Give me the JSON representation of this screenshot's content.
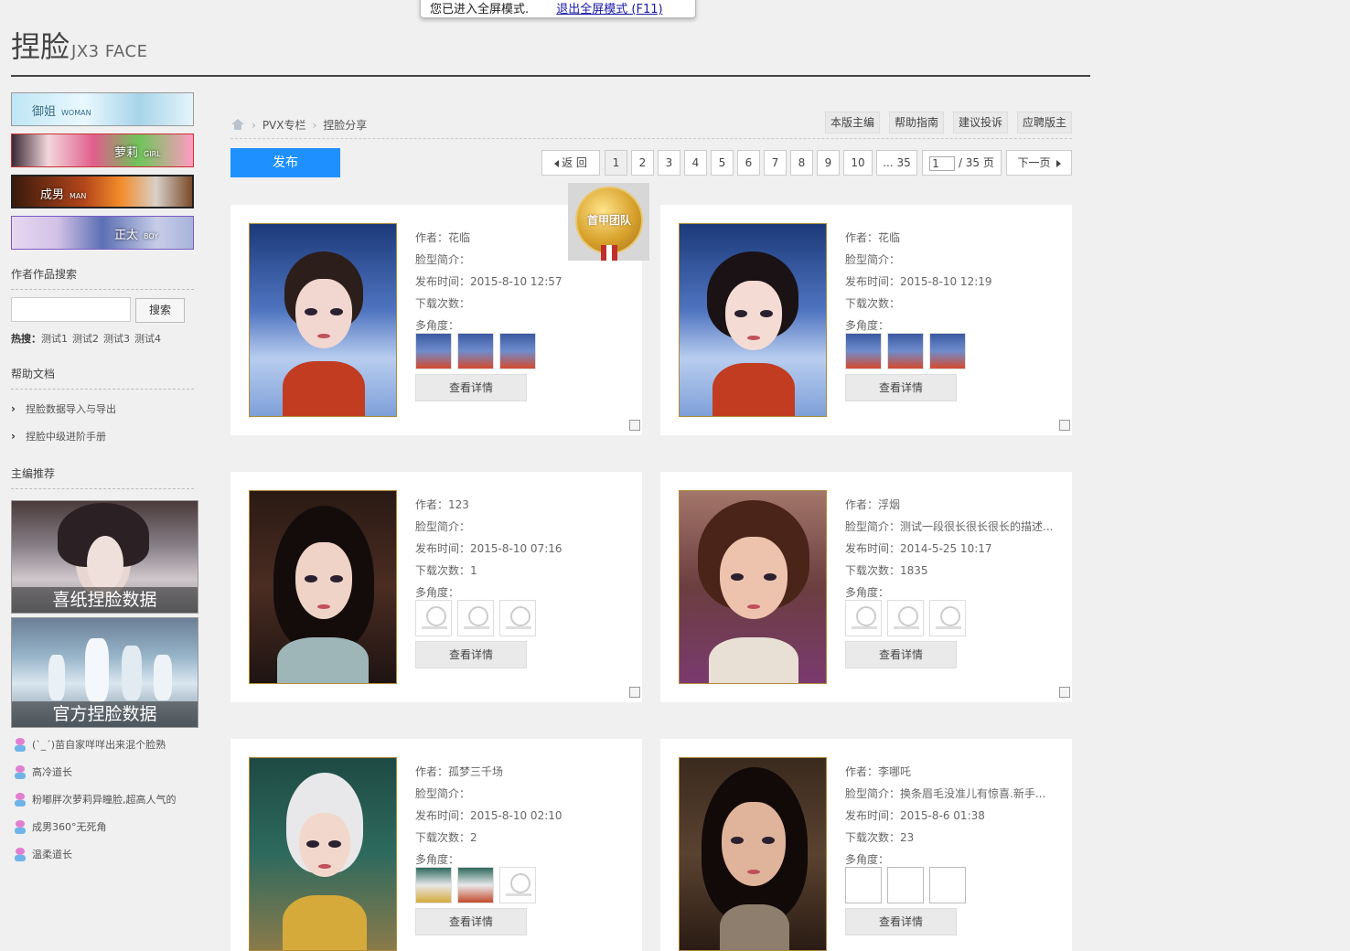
{
  "toast": {
    "message": "您已进入全屏模式.",
    "exit_link": "退出全屏模式 (F11)"
  },
  "header": {
    "title": "捏脸",
    "subtitle": "JX3 FACE"
  },
  "sidebar": {
    "banners": [
      {
        "label": "御姐",
        "en": "WOMAN"
      },
      {
        "label": "萝莉",
        "en": "GIRL"
      },
      {
        "label": "成男",
        "en": "MAN"
      },
      {
        "label": "正太",
        "en": "BOY"
      }
    ],
    "search": {
      "heading": "作者作品搜索",
      "placeholder": "",
      "button": "搜索",
      "hot_label": "热搜：",
      "hot_terms": [
        "测试1",
        "测试2",
        "测试3",
        "测试4"
      ]
    },
    "help": {
      "heading": "帮助文档",
      "items": [
        "捏脸数据导入与导出",
        "捏脸中级进阶手册"
      ]
    },
    "recommend": {
      "heading": "主编推荐",
      "promos": [
        "喜纸捏脸数据",
        "官方捏脸数据"
      ],
      "items": [
        "(`_´)苗自家咩咩出来混个脸熟",
        "高冷道长",
        "粉嘟胖次萝莉异瞳脸,超高人气的",
        "成男360°无死角",
        "温柔道长"
      ]
    }
  },
  "main": {
    "breadcrumb": [
      "PVX专栏",
      "捏脸分享"
    ],
    "top_buttons": [
      "本版主编",
      "帮助指南",
      "建议投诉",
      "应聘版主"
    ],
    "publish_button": "发布",
    "pagination": {
      "prev": "返 回",
      "pages": [
        "1",
        "2",
        "3",
        "4",
        "5",
        "6",
        "7",
        "8",
        "9",
        "10"
      ],
      "ellipsis": "... 35",
      "current": "1",
      "total_label": "/ 35 页",
      "next": "下一页"
    },
    "medal_text": "首甲团队",
    "labels": {
      "author": "作者：",
      "intro": "脸型简介：",
      "time": "发布时间：",
      "downloads": "下载次数：",
      "angles": "多角度：",
      "detail": "查看详情"
    },
    "cards": [
      {
        "author": "花临",
        "intro": "",
        "time": "2015-8-10 12:57",
        "downloads": "",
        "angles": [
          "img",
          "img",
          "img"
        ]
      },
      {
        "author": "花临",
        "intro": "",
        "time": "2015-8-10 12:19",
        "downloads": "",
        "angles": [
          "img",
          "img",
          "img"
        ]
      },
      {
        "author": "123",
        "intro": "",
        "time": "2015-8-10 07:16",
        "downloads": "1",
        "angles": [
          "logo",
          "logo",
          "logo"
        ]
      },
      {
        "author": "浮烟",
        "intro": "测试一段很长很长很长的描述...",
        "time": "2014-5-25 10:17",
        "downloads": "1835",
        "angles": [
          "logo",
          "logo",
          "logo"
        ]
      },
      {
        "author": "孤梦三千场",
        "intro": "",
        "time": "2015-8-10 02:10",
        "downloads": "2",
        "angles": [
          "img",
          "img",
          "logo"
        ]
      },
      {
        "author": "李哪吒",
        "intro": "换条眉毛没准儿有惊喜.新手...",
        "time": "2015-8-6 01:38",
        "downloads": "23",
        "angles": [
          "empty",
          "empty",
          "empty"
        ]
      }
    ]
  },
  "colors": {
    "accent": "#1e90ff",
    "background": "#f0f0f0",
    "header_rule": "#444444"
  }
}
